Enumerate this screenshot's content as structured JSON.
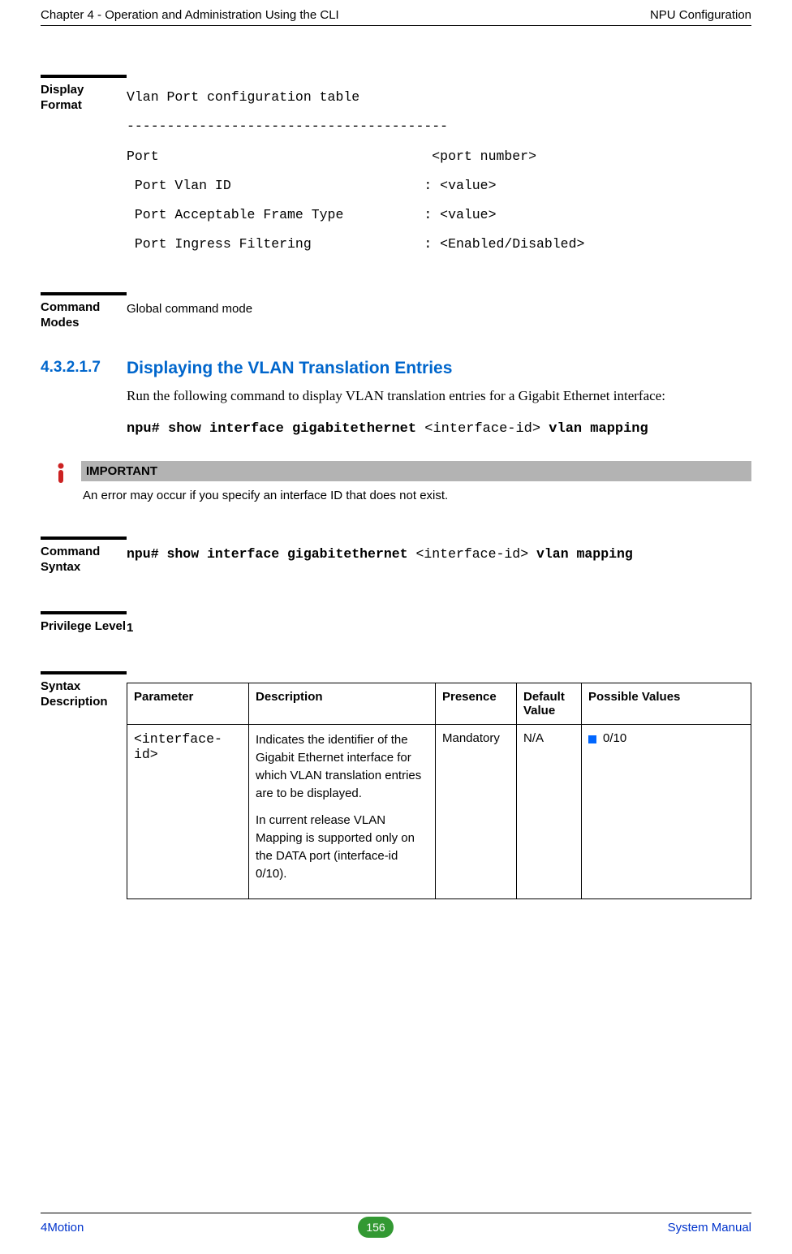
{
  "header": {
    "left": "Chapter 4 - Operation and Administration Using the CLI",
    "right": "NPU Configuration"
  },
  "display_format": {
    "label": "Display Format",
    "content": "Vlan Port configuration table\n----------------------------------------\nPort                                  <port number>\n Port Vlan ID                        : <value>\n Port Acceptable Frame Type          : <value>\n Port Ingress Filtering              : <Enabled/Disabled>"
  },
  "command_modes": {
    "label": "Command Modes",
    "value": "Global command mode"
  },
  "section": {
    "number": "4.3.2.1.7",
    "title": "Displaying the VLAN Translation Entries",
    "body": "Run the following command to display VLAN translation entries for a Gigabit Ethernet interface:",
    "cmd_prefix": "npu# show interface gigabitethernet ",
    "cmd_param": "<interface-id>",
    "cmd_suffix": " vlan mapping"
  },
  "important": {
    "label": "IMPORTANT",
    "text": "An error may occur if you specify an interface ID that does not exist."
  },
  "command_syntax": {
    "label": "Command Syntax",
    "cmd_prefix": "npu# show interface gigabitethernet ",
    "cmd_param": "<interface-id>",
    "cmd_suffix": " vlan mapping"
  },
  "privilege": {
    "label": "Privilege Level",
    "value": "1"
  },
  "syntax_desc": {
    "label": "Syntax Description",
    "headers": {
      "parameter": "Parameter",
      "description": "Description",
      "presence": "Presence",
      "default": "Default Value",
      "possible": "Possible Values"
    },
    "row": {
      "parameter": "<interface-id>",
      "desc1": "Indicates the identifier of the Gigabit Ethernet interface for which VLAN translation entries are to be displayed.",
      "desc2": "In current release VLAN Mapping is supported only on the DATA port (interface-id 0/10).",
      "presence": "Mandatory",
      "default": "N/A",
      "possible": "0/10"
    }
  },
  "footer": {
    "left": "4Motion",
    "page": "156",
    "right": "System Manual"
  }
}
